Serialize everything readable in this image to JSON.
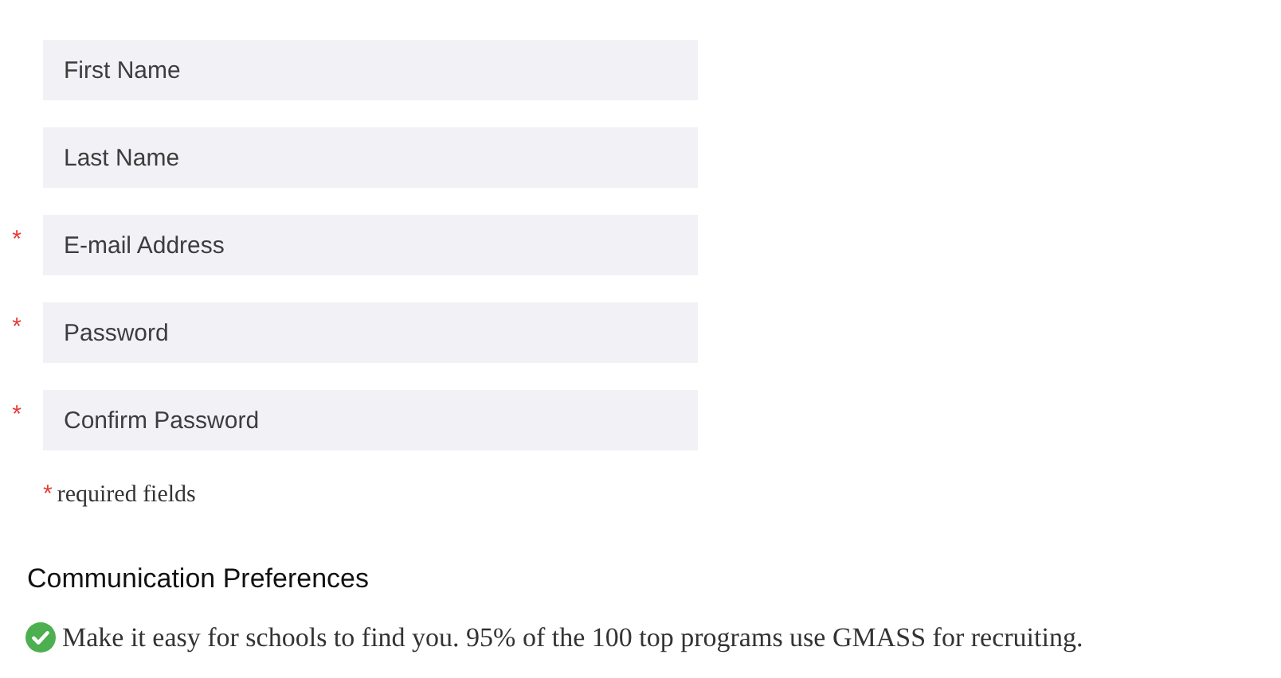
{
  "fields": [
    {
      "placeholder": "First Name"
    },
    {
      "placeholder": "Last Name"
    },
    {
      "placeholder": "E-mail Address",
      "required_mark": "*"
    },
    {
      "placeholder": "Password",
      "required_mark": "*"
    },
    {
      "placeholder": "Confirm Password",
      "required_mark": "*"
    }
  ],
  "required_note": {
    "mark": "*",
    "text": "required fields"
  },
  "section_title": "Communication Preferences",
  "info": "Make it easy for schools to find you. 95% of the 100 top programs use GMASS for recruiting."
}
